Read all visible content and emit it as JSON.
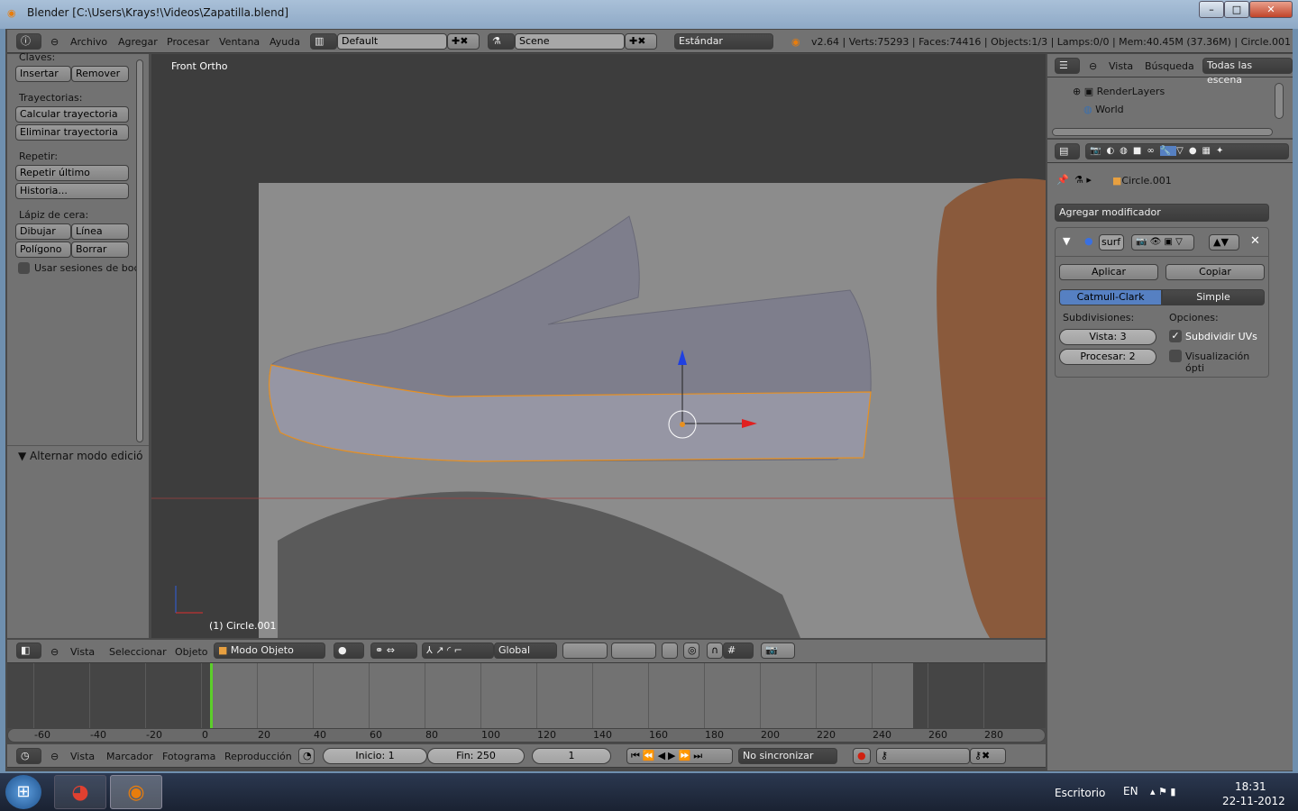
{
  "window": {
    "title": "Blender [C:\\Users\\Krays!\\Videos\\Zapatilla.blend]",
    "minimize": "–",
    "maximize": "□",
    "close": "✕"
  },
  "info_header": {
    "menus": [
      "Archivo",
      "Agregar",
      "Procesar",
      "Ventana",
      "Ayuda"
    ],
    "screen": "Default",
    "scene": "Scene",
    "engine": "Estándar",
    "stats": "v2.64 | Verts:75293 | Faces:74416 | Objects:1/3 | Lamps:0/0 | Mem:40.45M (37.36M) | Circle.001"
  },
  "toolshelf": {
    "claves_label": "Claves:",
    "insertar": "Insertar",
    "remover": "Remover",
    "trayectorias_label": "Trayectorias:",
    "calcular": "Calcular trayectoria",
    "eliminar": "Eliminar trayectoria",
    "repetir_label": "Repetir:",
    "repetir_ultimo": "Repetir último",
    "historia": "Historia...",
    "lapiz_label": "Lápiz de cera:",
    "dibujar": "Dibujar",
    "linea": "Línea",
    "poligono": "Polígono",
    "borrar": "Borrar",
    "usar_sesiones": "Usar sesiones de boc",
    "operator_panel": "Alternar modo edició"
  },
  "viewport": {
    "view_name": "Front Ortho",
    "object_label": "(1) Circle.001"
  },
  "view3d_header": {
    "menus": [
      "Vista",
      "Seleccionar",
      "Objeto"
    ],
    "mode": "Modo Objeto",
    "orientation": "Global"
  },
  "timeline": {
    "ticks": [
      "-60",
      "-40",
      "-20",
      "0",
      "20",
      "40",
      "60",
      "80",
      "100",
      "120",
      "140",
      "160",
      "180",
      "200",
      "220",
      "240",
      "260",
      "280"
    ],
    "current_frame": 0
  },
  "timeline_header": {
    "menus": [
      "Vista",
      "Marcador",
      "Fotograma",
      "Reproducción"
    ],
    "start": "Inicio: 1",
    "end": "Fin: 250",
    "frame": "1",
    "sync": "No sincronizar"
  },
  "outliner": {
    "menus": [
      "Vista",
      "Búsqueda"
    ],
    "filter": "Todas las escena",
    "items": [
      "RenderLayers",
      "World"
    ]
  },
  "properties": {
    "breadcrumb": "Circle.001",
    "add_modifier": "Agregar modificador",
    "modifier_name": "surf",
    "apply": "Aplicar",
    "copy": "Copiar",
    "catmull": "Catmull-Clark",
    "simple": "Simple",
    "subdiv_label": "Subdivisiones:",
    "options_label": "Opciones:",
    "view_levels": "Vista: 3",
    "render_levels": "Procesar: 2",
    "subdivide_uvs": "Subdividir UVs",
    "subdivide_uvs_checked": true,
    "optimal_display": "Visualización ópti",
    "optimal_display_checked": false,
    "accent": "#5680c2"
  },
  "taskbar": {
    "desktop": "Escritorio",
    "lang": "EN",
    "time": "18:31",
    "date": "22-11-2012"
  }
}
